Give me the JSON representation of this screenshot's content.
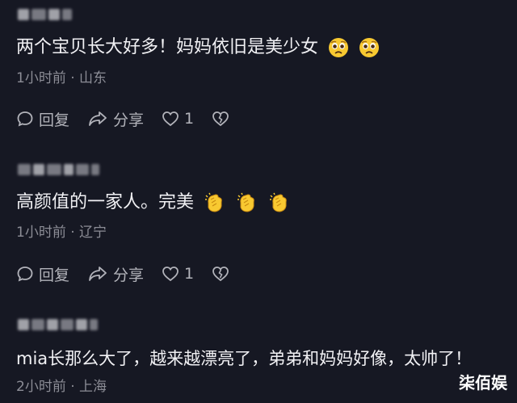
{
  "comments": [
    {
      "text": "两个宝贝长大好多！妈妈依旧是美少女",
      "emojis": [
        "pleading-face-emoji",
        "pleading-face-emoji"
      ],
      "meta": "1小时前 · 山东",
      "reply_label": "回复",
      "share_label": "分享",
      "likes": "1"
    },
    {
      "text": "高颜值的一家人。完美",
      "emojis": [
        "clapping-hands-emoji",
        "clapping-hands-emoji",
        "clapping-hands-emoji"
      ],
      "meta": "1小时前 · 辽宁",
      "reply_label": "回复",
      "share_label": "分享",
      "likes": "1"
    },
    {
      "text": "mia长那么大了，越来越漂亮了，弟弟和妈妈好像，太帅了！",
      "emojis": [],
      "meta": "2小时前 · 上海"
    }
  ],
  "watermark": "柒佰娱",
  "colors": {
    "background": "#161823",
    "text": "#f1f1f4",
    "muted": "#8c8d96",
    "action": "#b2b3ba"
  }
}
